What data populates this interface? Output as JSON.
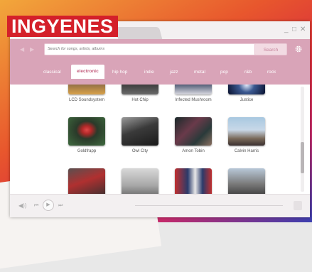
{
  "overlay": {
    "logo_text": "INGYENES"
  },
  "window": {
    "controls": {
      "minimize": "_",
      "maximize": "□",
      "close": "✕"
    }
  },
  "header": {
    "search_placeholder": "Search for songs, artists, albums",
    "search_button": "Search",
    "icons": [
      "back-arrow-icon",
      "forward-arrow-icon",
      "gear-icon"
    ]
  },
  "genres": {
    "active": "electronic",
    "items": [
      "classical",
      "electronic",
      "hip hop",
      "indie",
      "jazz",
      "metal",
      "pop",
      "r&b",
      "rock"
    ]
  },
  "artists": {
    "row1": [
      "LCD Soundsystem",
      "Hot Chip",
      "Infected Mushroom",
      "Justice"
    ],
    "row2": [
      "Goldfrapp",
      "Owl City",
      "Amon Tobin",
      "Calvin Harris"
    ],
    "row3": [
      "",
      "",
      "",
      ""
    ]
  },
  "player": {
    "icons": [
      "volume-icon",
      "previous-icon",
      "play-icon",
      "next-icon",
      "save-icon"
    ],
    "volume_glyph": "◀))",
    "prev_glyph": "⏮",
    "play_glyph": "▶",
    "next_glyph": "⏭"
  },
  "colors": {
    "accent_pink": "#d9a4b8",
    "active_genre_text": "#c4607f",
    "logo_red": "#d4202a"
  }
}
